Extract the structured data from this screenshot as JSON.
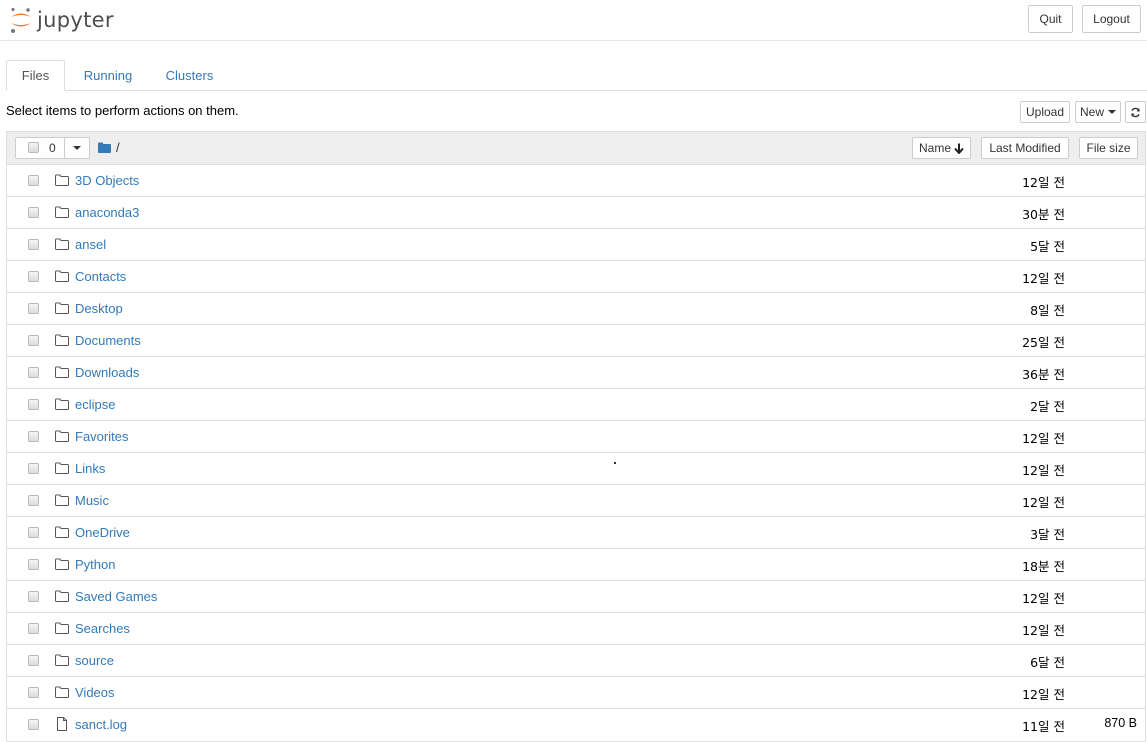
{
  "header": {
    "logo_text": "jupyter",
    "quit_label": "Quit",
    "logout_label": "Logout"
  },
  "tabs": [
    {
      "label": "Files",
      "active": true
    },
    {
      "label": "Running",
      "active": false
    },
    {
      "label": "Clusters",
      "active": false
    }
  ],
  "toolbar": {
    "hint": "Select items to perform actions on them.",
    "upload_label": "Upload",
    "new_label": "New",
    "refresh_icon": "refresh-icon"
  },
  "list_header": {
    "selected_count": "0",
    "path": "/",
    "sort_name_label": "Name",
    "last_modified_label": "Last Modified",
    "file_size_label": "File size"
  },
  "items": [
    {
      "type": "folder",
      "name": "3D Objects",
      "modified": "12일 전",
      "size": ""
    },
    {
      "type": "folder",
      "name": "anaconda3",
      "modified": "30분 전",
      "size": ""
    },
    {
      "type": "folder",
      "name": "ansel",
      "modified": "5달 전",
      "size": ""
    },
    {
      "type": "folder",
      "name": "Contacts",
      "modified": "12일 전",
      "size": ""
    },
    {
      "type": "folder",
      "name": "Desktop",
      "modified": "8일 전",
      "size": ""
    },
    {
      "type": "folder",
      "name": "Documents",
      "modified": "25일 전",
      "size": ""
    },
    {
      "type": "folder",
      "name": "Downloads",
      "modified": "36분 전",
      "size": ""
    },
    {
      "type": "folder",
      "name": "eclipse",
      "modified": "2달 전",
      "size": ""
    },
    {
      "type": "folder",
      "name": "Favorites",
      "modified": "12일 전",
      "size": ""
    },
    {
      "type": "folder",
      "name": "Links",
      "modified": "12일 전",
      "size": ""
    },
    {
      "type": "folder",
      "name": "Music",
      "modified": "12일 전",
      "size": ""
    },
    {
      "type": "folder",
      "name": "OneDrive",
      "modified": "3달 전",
      "size": ""
    },
    {
      "type": "folder",
      "name": "Python",
      "modified": "18분 전",
      "size": ""
    },
    {
      "type": "folder",
      "name": "Saved Games",
      "modified": "12일 전",
      "size": ""
    },
    {
      "type": "folder",
      "name": "Searches",
      "modified": "12일 전",
      "size": ""
    },
    {
      "type": "folder",
      "name": "source",
      "modified": "6달 전",
      "size": ""
    },
    {
      "type": "folder",
      "name": "Videos",
      "modified": "12일 전",
      "size": ""
    },
    {
      "type": "file",
      "name": "sanct.log",
      "modified": "11일 전",
      "size": "870 B"
    }
  ],
  "colors": {
    "link": "#337ab7",
    "brand_orange": "#f37726",
    "header_bg": "#eeeeee"
  }
}
